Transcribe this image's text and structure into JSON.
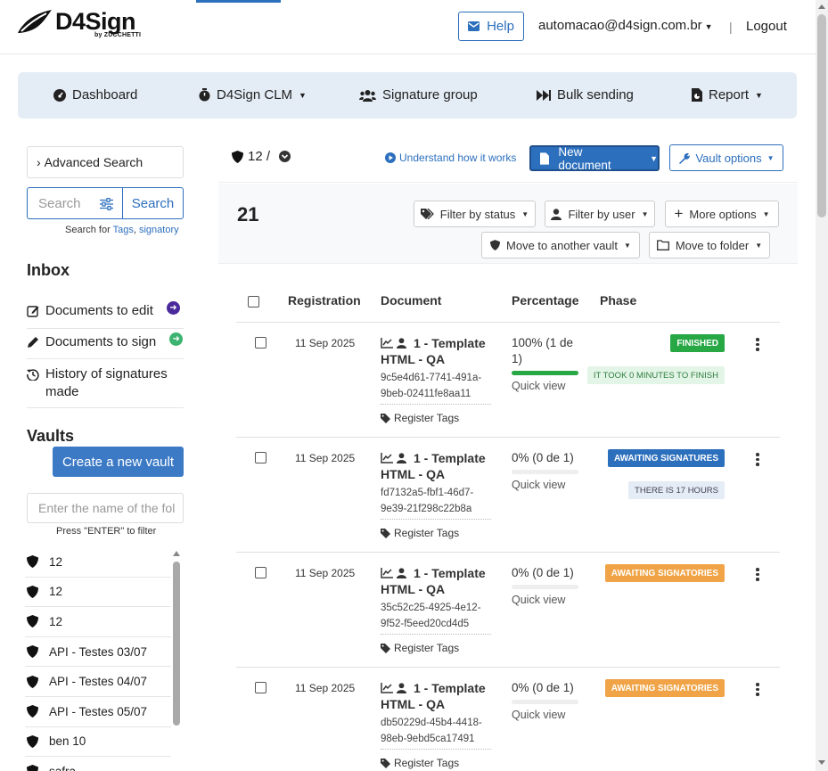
{
  "brand": {
    "name": "D4Sign",
    "sub": "by ZUCCHETTI"
  },
  "header": {
    "help": "Help",
    "user_email": "automacao@d4sign.com.br",
    "separator": "|",
    "logout": "Logout"
  },
  "nav": {
    "dashboard": "Dashboard",
    "clm": "D4Sign CLM",
    "signature_group": "Signature group",
    "bulk_sending": "Bulk sending",
    "report": "Report"
  },
  "sidebar": {
    "advanced_search": "Advanced Search",
    "search_placeholder": "Search",
    "search_button": "Search",
    "search_hint_prefix": "Search for ",
    "search_hint_tags": "Tags",
    "search_hint_sep": ", ",
    "search_hint_signatory": "signatory",
    "inbox_title": "Inbox",
    "inbox": [
      {
        "label": "Documents to edit",
        "icon": "edit-icon"
      },
      {
        "label": "Documents to sign",
        "icon": "pen-icon"
      },
      {
        "label": "History of signatures made",
        "icon": "history-icon"
      }
    ],
    "vaults_title": "Vaults",
    "create_vault": "Create a new vault",
    "vault_filter_placeholder": "Enter the name of the fol",
    "vault_filter_hint": "Press \"ENTER\" to filter",
    "vaults": [
      "12",
      "12",
      "12",
      "API - Testes 03/07",
      "API - Testes 04/07",
      "API - Testes 05/07",
      "ben 10",
      "safra"
    ]
  },
  "main": {
    "vault_count": "12 /",
    "understand": "Understand how it works",
    "new_document": "New document",
    "vault_options": "Vault options",
    "total": "21",
    "filters": {
      "status": "Filter by status",
      "user": "Filter by user",
      "more": "More options",
      "move_vault": "Move to another vault",
      "move_folder": "Move to folder"
    }
  },
  "table": {
    "headers": {
      "registration": "Registration",
      "document": "Document",
      "percentage": "Percentage",
      "phase": "Phase"
    },
    "rows": [
      {
        "date": "11 Sep 2025",
        "title": "1 - Template HTML - QA",
        "uuid": "9c5e4d61-7741-491a-9beb-02411fe8aa11",
        "tags": "Register Tags",
        "pct_text": "100% (1 de 1)",
        "pct": 1.0,
        "quick_view": "Quick view",
        "phase": "FINISHED",
        "phase_color": "#28a745",
        "sub": "IT TOOK 0 MINUTES TO FINISH",
        "sub_bg": "#e3f5e6",
        "sub_color": "#2f7d3f"
      },
      {
        "date": "11 Sep 2025",
        "title": "1 - Template HTML - QA",
        "uuid": "fd7132a5-fbf1-46d7-9e39-21f298c22b8a",
        "tags": "Register Tags",
        "pct_text": "0% (0 de 1)",
        "pct": 0,
        "quick_view": "Quick view",
        "phase": "AWAITING SIGNATURES",
        "phase_color": "#2c6fbd",
        "sub": "THERE IS 17 HOURS",
        "sub_bg": "#e4ecf5",
        "sub_color": "#445"
      },
      {
        "date": "11 Sep 2025",
        "title": "1 - Template HTML - QA",
        "uuid": "35c52c25-4925-4e12-9f52-f5eed20cd4d5",
        "tags": "Register Tags",
        "pct_text": "0% (0 de 1)",
        "pct": 0,
        "quick_view": "Quick view",
        "phase": "AWAITING SIGNATORIES",
        "phase_color": "#f0a447",
        "sub": "",
        "sub_bg": "",
        "sub_color": ""
      },
      {
        "date": "11 Sep 2025",
        "title": "1 - Template HTML - QA",
        "uuid": "db50229d-45b4-4418-98eb-9ebd5ca17491",
        "tags": "Register Tags",
        "pct_text": "0% (0 de 1)",
        "pct": 0,
        "quick_view": "Quick view",
        "phase": "AWAITING SIGNATORIES",
        "phase_color": "#f0a447",
        "sub": "",
        "sub_bg": "",
        "sub_color": ""
      }
    ]
  }
}
